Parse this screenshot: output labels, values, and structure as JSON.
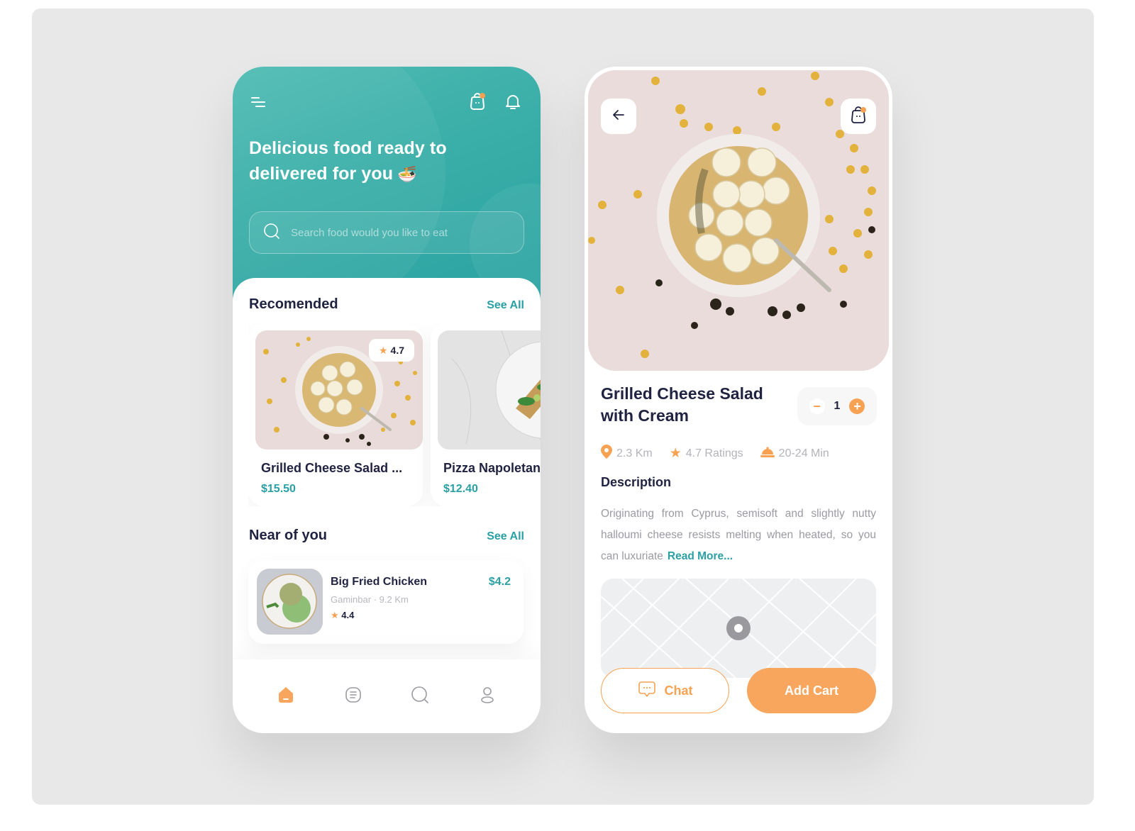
{
  "colors": {
    "teal": "#2aa0a5",
    "orange": "#f7a253",
    "navy": "#1f2240",
    "muted": "#b3b3ba"
  },
  "home": {
    "header": {
      "menu_icon": "menu-icon",
      "bag_icon": "shopping-bag-icon",
      "bell_icon": "bell-icon",
      "title": "Delicious food ready to delivered for you",
      "title_emoji": "🍜"
    },
    "search": {
      "placeholder": "Search food would you like to eat",
      "value": ""
    },
    "recommended": {
      "title": "Recomended",
      "see_all": "See All",
      "items": [
        {
          "name": "Grilled Cheese Salad ...",
          "price": "$15.50",
          "rating": "4.7"
        },
        {
          "name": "Pizza Napoletana",
          "price": "$12.40"
        }
      ]
    },
    "near": {
      "title": "Near of you",
      "see_all": "See All",
      "items": [
        {
          "name": "Big Fried Chicken",
          "place": "Gaminbar",
          "distance": "9.2 Km",
          "rating": "4.4",
          "price": "$4.2"
        }
      ]
    },
    "tabbar": [
      {
        "icon": "home-icon",
        "active": true
      },
      {
        "icon": "orders-icon",
        "active": false
      },
      {
        "icon": "search-icon",
        "active": false
      },
      {
        "icon": "profile-icon",
        "active": false
      }
    ]
  },
  "detail": {
    "title": "Grilled Cheese Salad with Cream",
    "quantity": "1",
    "distance": "2.3 Km",
    "rating": "4.7 Ratings",
    "delivery_time": "20-24 Min",
    "description_title": "Description",
    "description": "Originating from Cyprus, semisoft and slightly nutty halloumi cheese resists melting when heated, so you can luxuriate",
    "read_more": "Read More...",
    "chat_label": "Chat",
    "add_cart_label": "Add Cart"
  }
}
